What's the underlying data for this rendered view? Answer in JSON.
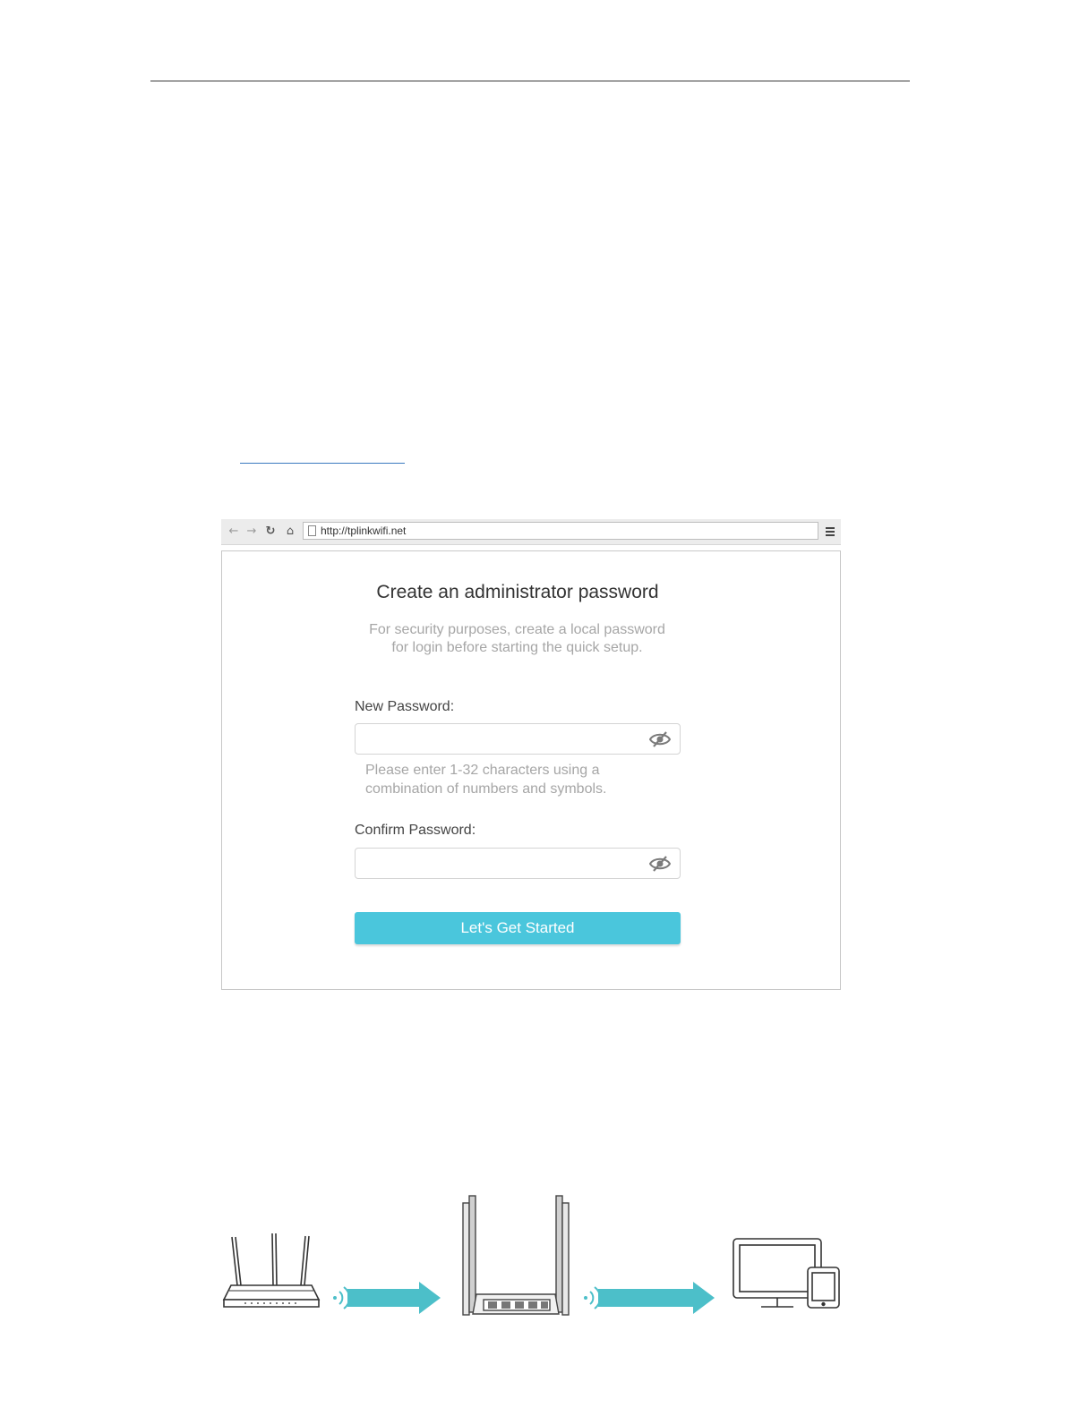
{
  "browser": {
    "url": "http://tplinkwifi.net",
    "back_icon": "back-arrow-icon",
    "forward_icon": "forward-arrow-icon",
    "reload_icon": "reload-icon",
    "home_icon": "home-icon",
    "menu_icon": "hamburger-menu-icon"
  },
  "form": {
    "title": "Create an administrator password",
    "description_line1": "For security purposes, create a local password",
    "description_line2": "for login before starting the quick setup.",
    "new_password_label": "New Password:",
    "new_password_value": "",
    "hint_line1": "Please enter 1-32 characters using a",
    "hint_line2": "combination of numbers and symbols.",
    "confirm_password_label": "Confirm Password:",
    "confirm_password_value": "",
    "submit_label": "Let's Get Started"
  },
  "colors": {
    "accent": "#4ac6dc",
    "arrow": "#4cbfc9",
    "muted_text": "#a6a6a6"
  },
  "diagram": {
    "icons": [
      "host-router-icon",
      "wifi-signal-icon",
      "arrow-icon",
      "extender-router-icon",
      "wifi-signal-icon",
      "arrow-icon",
      "monitor-icon",
      "tablet-icon"
    ]
  }
}
